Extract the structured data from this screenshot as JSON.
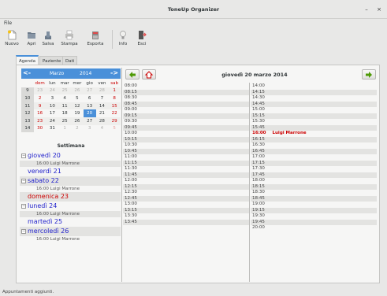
{
  "window": {
    "title": "ToneUp Organizer",
    "minimize_glyph": "–",
    "close_glyph": "×"
  },
  "menu": {
    "file": "File"
  },
  "toolbar": {
    "items": [
      {
        "label": "Nuovo",
        "icon": "new-document-icon"
      },
      {
        "label": "Apri",
        "icon": "open-folder-icon"
      },
      {
        "label": "Salva",
        "icon": "save-icon"
      },
      {
        "label": "Stampa",
        "icon": "print-icon"
      },
      {
        "label": "Esporta",
        "icon": "export-icon"
      },
      {
        "label": "Info",
        "icon": "info-lightbulb-icon"
      },
      {
        "label": "Esci",
        "icon": "exit-icon"
      }
    ]
  },
  "tabs": [
    "Agenda",
    "Paziente",
    "Dati"
  ],
  "calendar": {
    "prev": "<-",
    "next": "->",
    "month": "Marzo",
    "year": "2014",
    "accent": "#4a90d9",
    "headers": [
      "dom",
      "lun",
      "mar",
      "mer",
      "gio",
      "ven",
      "sab"
    ],
    "weeks": [
      {
        "num": "9",
        "days": [
          "23",
          "24",
          "25",
          "26",
          "27",
          "28",
          "1"
        ]
      },
      {
        "num": "10",
        "days": [
          "2",
          "3",
          "4",
          "5",
          "6",
          "7",
          "8"
        ]
      },
      {
        "num": "11",
        "days": [
          "9",
          "10",
          "11",
          "12",
          "13",
          "14",
          "15"
        ]
      },
      {
        "num": "12",
        "days": [
          "16",
          "17",
          "18",
          "19",
          "20",
          "21",
          "22"
        ]
      },
      {
        "num": "13",
        "days": [
          "23",
          "24",
          "25",
          "26",
          "27",
          "28",
          "29"
        ]
      },
      {
        "num": "14",
        "days": [
          "30",
          "31",
          "1",
          "2",
          "3",
          "4",
          "5"
        ]
      }
    ]
  },
  "week": {
    "title": "Settimana",
    "days": [
      {
        "label": "giovedì 20",
        "appts": [
          "16:00 Luigi Marrone"
        ]
      },
      {
        "label": "venerdì 21",
        "appts": []
      },
      {
        "label": "sabato 22",
        "appts": [
          "16:00 Luigi Marrone"
        ]
      },
      {
        "label": "domenica 23",
        "appts": []
      },
      {
        "label": "lunedì 24",
        "appts": [
          "16:00 Luigi Marrone"
        ]
      },
      {
        "label": "martedì 25",
        "appts": []
      },
      {
        "label": "mercoledì 26",
        "appts": [
          "16:00 Luigi Marrone"
        ]
      }
    ]
  },
  "day": {
    "title": "giovedì 20 marzo 2014",
    "morning": [
      "08:00",
      "08:15",
      "08:30",
      "08:45",
      "09:00",
      "09:15",
      "09:30",
      "09:45",
      "10:00",
      "10:15",
      "10:30",
      "10:45",
      "11:00",
      "11:15",
      "11:30",
      "11:45",
      "12:00",
      "12:15",
      "12:30",
      "12:45",
      "13:00",
      "13:15",
      "13:30",
      "13:45"
    ],
    "afternoon": [
      "14:00",
      "14:15",
      "14:30",
      "14:45",
      "15:00",
      "15:15",
      "15:30",
      "15:45",
      "16:00",
      "16:15",
      "16:30",
      "16:45",
      "17:00",
      "17:15",
      "17:30",
      "17:45",
      "18:00",
      "18:15",
      "18:30",
      "18:45",
      "19:00",
      "19:15",
      "19:30",
      "19:45",
      "20:00"
    ],
    "appointment": {
      "time": "16:00",
      "name": "Luigi Marrone",
      "color": "#cc0000"
    }
  },
  "status": "Appuntamenti aggiunti."
}
